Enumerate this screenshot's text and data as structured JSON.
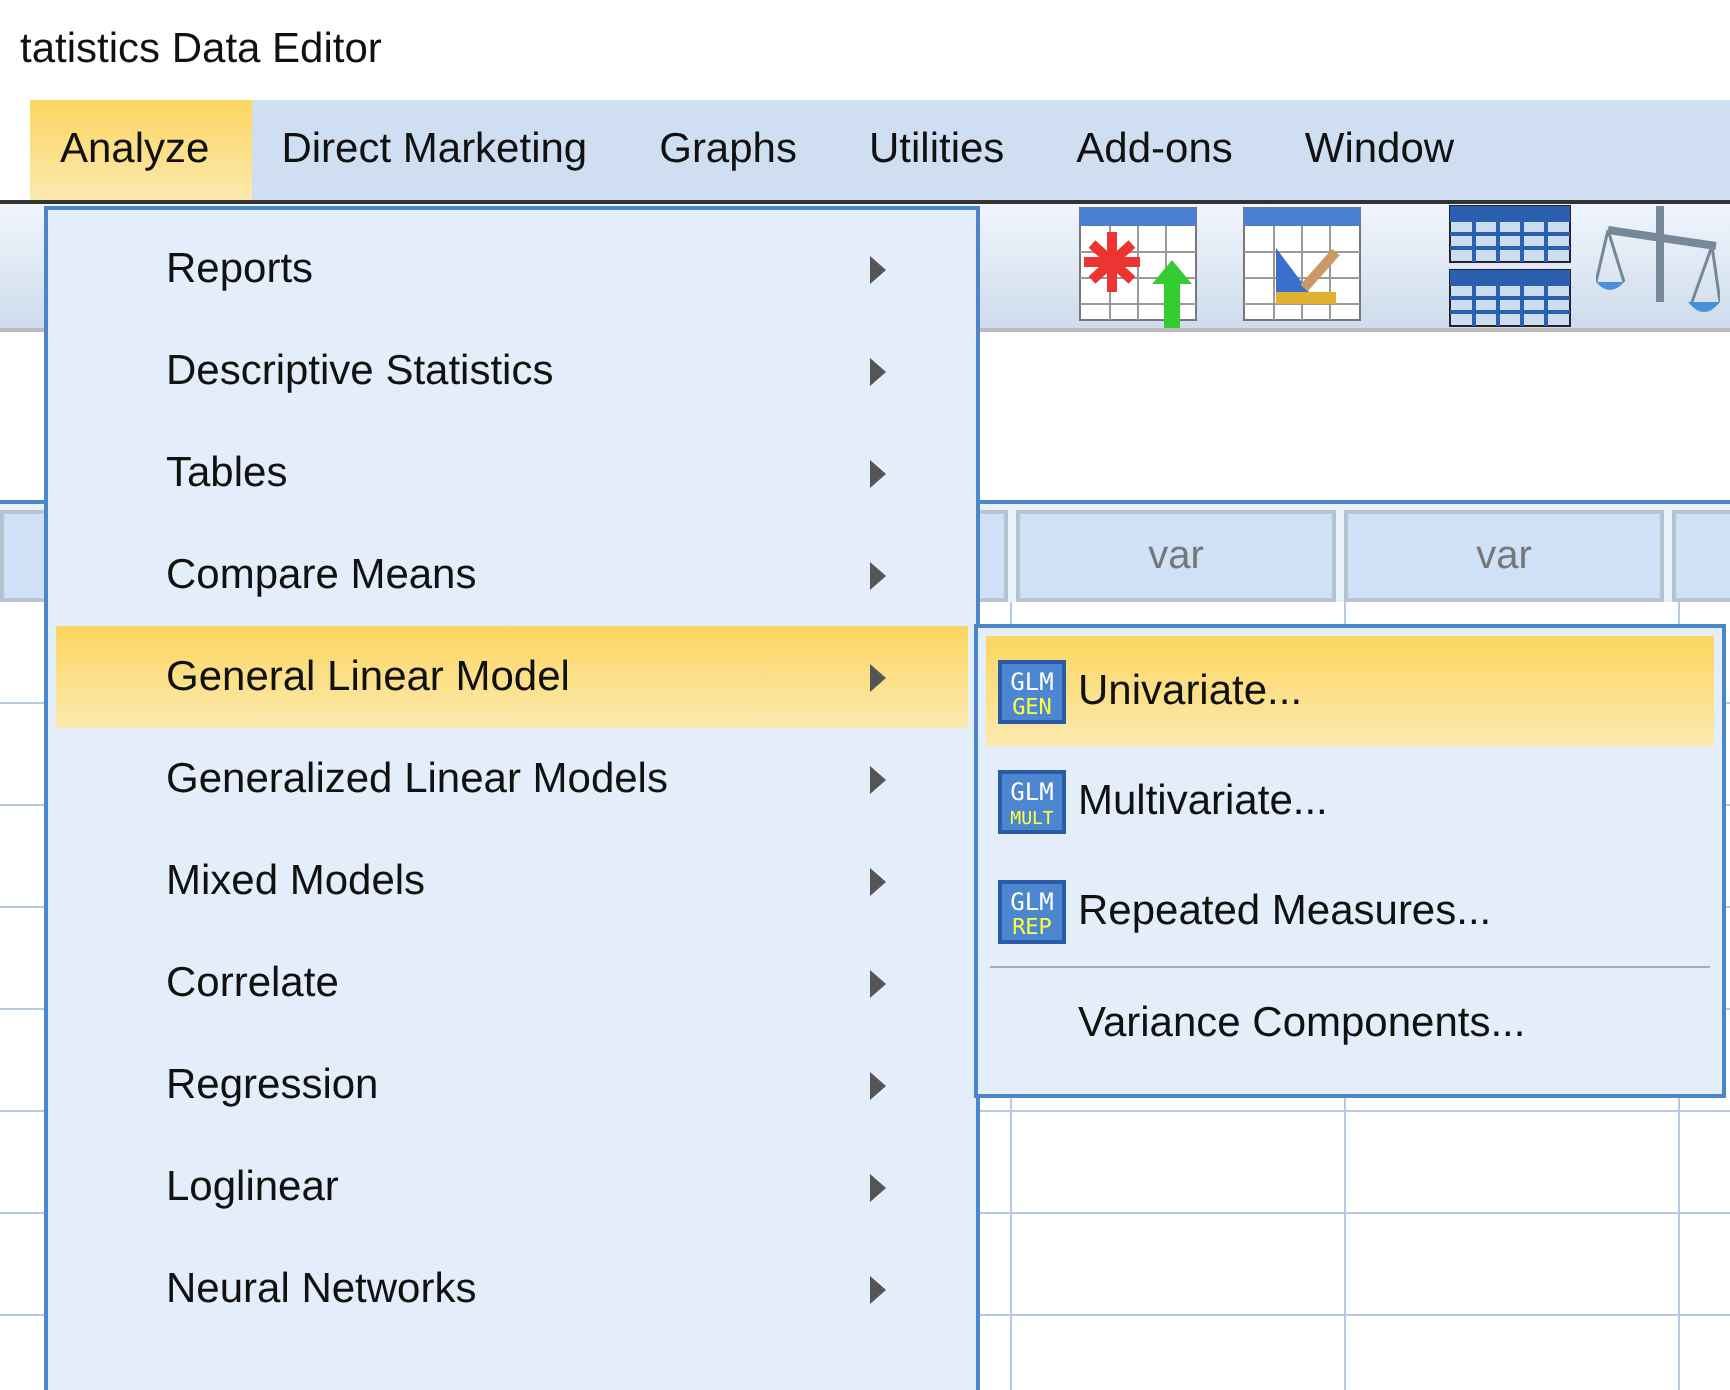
{
  "window": {
    "title": "tatistics Data Editor"
  },
  "menu_bar": [
    {
      "label": "Analyze",
      "selected": true
    },
    {
      "label": "Direct Marketing",
      "selected": false
    },
    {
      "label": "Graphs",
      "selected": false
    },
    {
      "label": "Utilities",
      "selected": false
    },
    {
      "label": "Add-ons",
      "selected": false
    },
    {
      "label": "Window",
      "selected": false
    }
  ],
  "grid": {
    "columns": [
      "var",
      "var"
    ]
  },
  "analyze_menu": [
    {
      "label": "Reports",
      "selected": false,
      "has_submenu": true
    },
    {
      "label": "Descriptive Statistics",
      "selected": false,
      "has_submenu": true
    },
    {
      "label": "Tables",
      "selected": false,
      "has_submenu": true
    },
    {
      "label": "Compare Means",
      "selected": false,
      "has_submenu": true
    },
    {
      "label": "General Linear Model",
      "selected": true,
      "has_submenu": true
    },
    {
      "label": "Generalized Linear Models",
      "selected": false,
      "has_submenu": true
    },
    {
      "label": "Mixed Models",
      "selected": false,
      "has_submenu": true
    },
    {
      "label": "Correlate",
      "selected": false,
      "has_submenu": true
    },
    {
      "label": "Regression",
      "selected": false,
      "has_submenu": true
    },
    {
      "label": "Loglinear",
      "selected": false,
      "has_submenu": true
    },
    {
      "label": "Neural Networks",
      "selected": false,
      "has_submenu": true
    }
  ],
  "glm_submenu": [
    {
      "label": "Univariate...",
      "selected": true,
      "separator_before": false,
      "badge": {
        "top": "GLM",
        "bottom": "GEN"
      }
    },
    {
      "label": "Multivariate...",
      "selected": false,
      "separator_before": false,
      "badge": {
        "top": "GLM",
        "bottom": "MULT"
      }
    },
    {
      "label": "Repeated Measures...",
      "selected": false,
      "separator_before": false,
      "badge": {
        "top": "GLM",
        "bottom": "REP"
      }
    },
    {
      "label": "Variance Components...",
      "selected": false,
      "separator_before": true
    }
  ]
}
